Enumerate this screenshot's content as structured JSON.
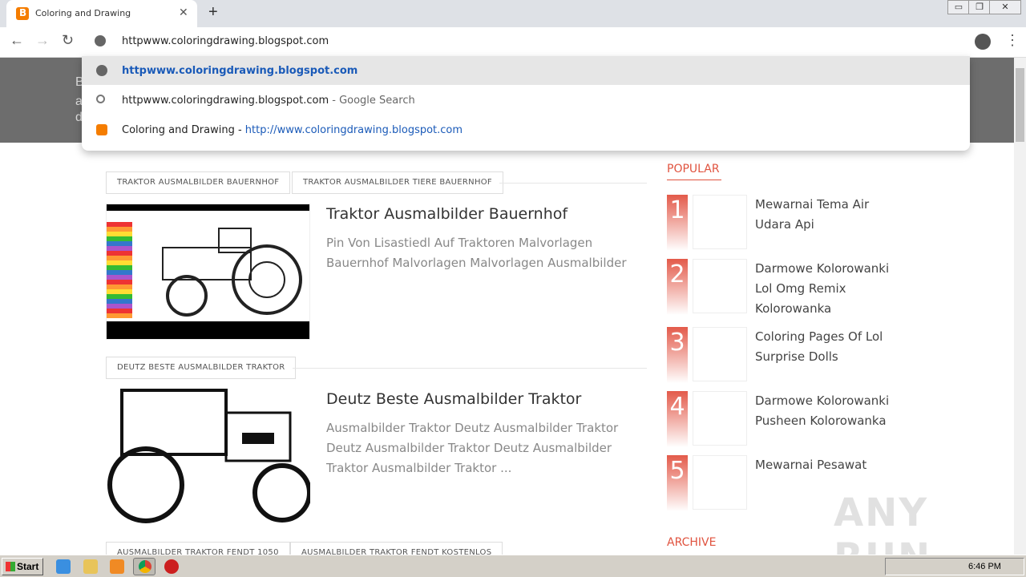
{
  "tab": {
    "title": "Coloring and Drawing",
    "close": "✕",
    "new_tab": "+"
  },
  "window": {
    "minimize": "▭",
    "restore": "❐",
    "close": "✕"
  },
  "toolbar": {
    "back": "←",
    "forward": "→",
    "reload": "↻",
    "omnibox_value": "httpwww.coloringdrawing.blogspot.com",
    "menu": "⋮"
  },
  "suggestions": [
    {
      "text": "httpwww.coloringdrawing.blogspot.com",
      "suffix": "",
      "icon": "globe-icon"
    },
    {
      "text": "httpwww.coloringdrawing.blogspot.com",
      "suffix": " - Google Search",
      "icon": "search-icon"
    },
    {
      "text": "Coloring and Drawing",
      "suffix": " - ",
      "link": "http://www.coloringdrawing.blogspot.com",
      "icon": "blogger-icon"
    }
  ],
  "hero": {
    "letters": [
      "B",
      "a",
      "d"
    ]
  },
  "posts": [
    {
      "tags": [
        "TRAKTOR AUSMALBILDER BAUERNHOF",
        "TRAKTOR AUSMALBILDER TIERE BAUERNHOF"
      ],
      "title": "Traktor Ausmalbilder Bauernhof",
      "desc": "Pin Von Lisastiedl Auf Traktoren Malvorlagen Bauernhof Malvorlagen Malvorlagen Ausmalbilder"
    },
    {
      "tags": [
        "DEUTZ BESTE AUSMALBILDER TRAKTOR"
      ],
      "title": "Deutz Beste Ausmalbilder Traktor",
      "desc": "Ausmalbilder Traktor Deutz Ausmalbilder Traktor Deutz Ausmalbilder Traktor Deutz Ausmalbilder Traktor Ausmalbilder Traktor ..."
    },
    {
      "tags": [
        "AUSMALBILDER TRAKTOR FENDT 1050",
        "AUSMALBILDER TRAKTOR FENDT KOSTENLOS"
      ]
    }
  ],
  "sidebar": {
    "popular_heading": "POPULAR",
    "archive_heading": "ARCHIVE",
    "popular": [
      {
        "rank": "1",
        "title": "Mewarnai Tema Air Udara Api"
      },
      {
        "rank": "2",
        "title": "Darmowe Kolorowanki Lol Omg Remix Kolorowanka"
      },
      {
        "rank": "3",
        "title": "Coloring Pages Of Lol Surprise Dolls"
      },
      {
        "rank": "4",
        "title": "Darmowe Kolorowanki Pusheen Kolorowanka"
      },
      {
        "rank": "5",
        "title": "Mewarnai Pesawat"
      }
    ]
  },
  "watermark": "ANY RUN",
  "taskbar": {
    "start": "Start",
    "clock": "6:46 PM"
  }
}
